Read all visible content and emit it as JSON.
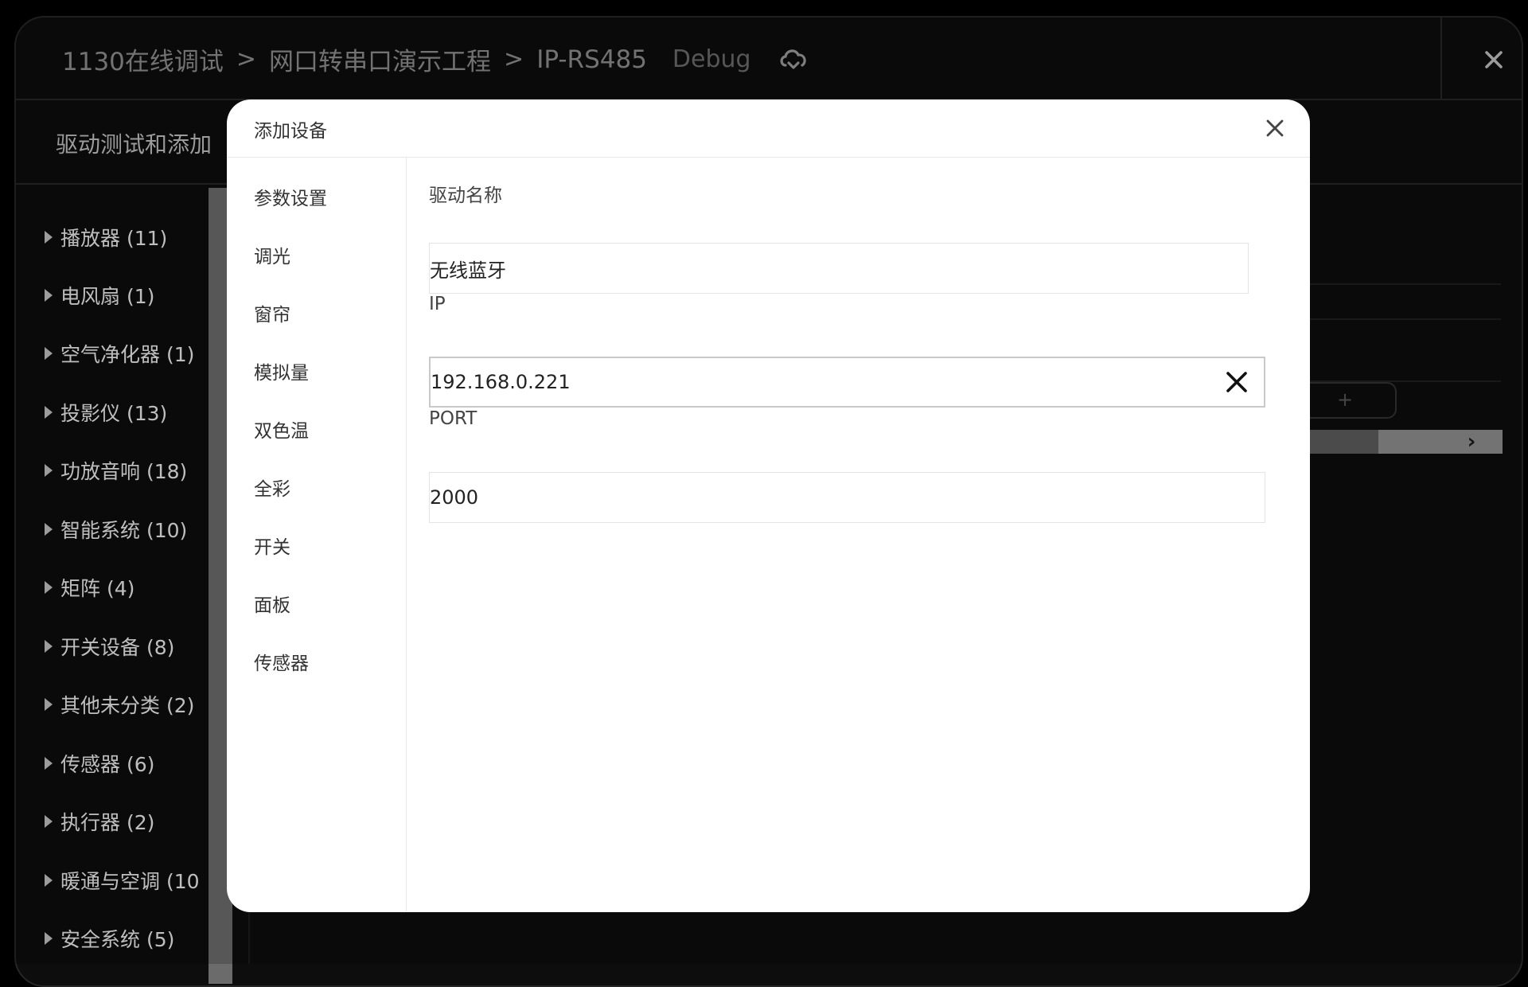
{
  "breadcrumb": {
    "items": [
      "1130在线调试",
      "网口转串口演示工程",
      "IP-RS485"
    ],
    "separator": ">",
    "mode": "Debug"
  },
  "section": {
    "title": "驱动测试和添加"
  },
  "categories": [
    "播放器 (11)",
    "电风扇 (1)",
    "空气净化器 (1)",
    "投影仪 (13)",
    "功放音响 (18)",
    "智能系统 (10)",
    "矩阵 (4)",
    "开关设备 (8)",
    "其他未分类 (2)",
    "传感器 (6)",
    "执行器 (2)",
    "暖通与空调 (10",
    "安全系统 (5)"
  ],
  "background": {
    "add_button_label": "+"
  },
  "modal": {
    "title": "添加设备",
    "nav": [
      "参数设置",
      "调光",
      "窗帘",
      "模拟量",
      "双色温",
      "全彩",
      "开关",
      "面板",
      "传感器"
    ],
    "fields": {
      "driver_name": {
        "label": "驱动名称",
        "value": "无线蓝牙"
      },
      "ip": {
        "label": "IP",
        "value": "192.168.0.221"
      },
      "port": {
        "label": "PORT",
        "value": "2000"
      }
    }
  },
  "colors": {
    "background": "#000000",
    "window": "#0d0d0d",
    "modal": "#ffffff"
  }
}
